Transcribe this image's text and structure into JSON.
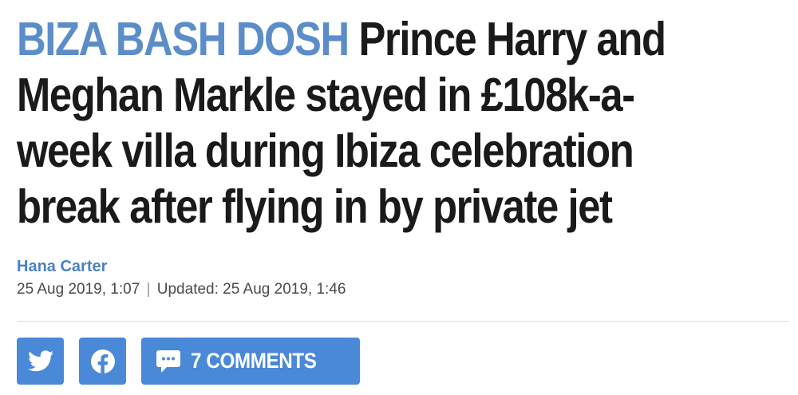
{
  "article": {
    "kicker": "BIZA BASH DOSH",
    "headline": "Prince Harry and Meghan Markle stayed in £108k-a-week villa during Ibiza celebration break after flying in by private jet",
    "author": "Hana Carter",
    "published": "25 Aug 2019, 1:07",
    "updated_prefix": "Updated:",
    "updated": "25 Aug 2019, 1:46"
  },
  "share": {
    "twitter_icon": "twitter-icon",
    "facebook_icon": "facebook-icon",
    "comments_icon": "speech-bubble-icon",
    "comments_label": "7 COMMENTS"
  },
  "colors": {
    "kicker": "#5b8dc9",
    "headline": "#1a1a1a",
    "author": "#4a82c3",
    "button": "#4a88d8"
  }
}
